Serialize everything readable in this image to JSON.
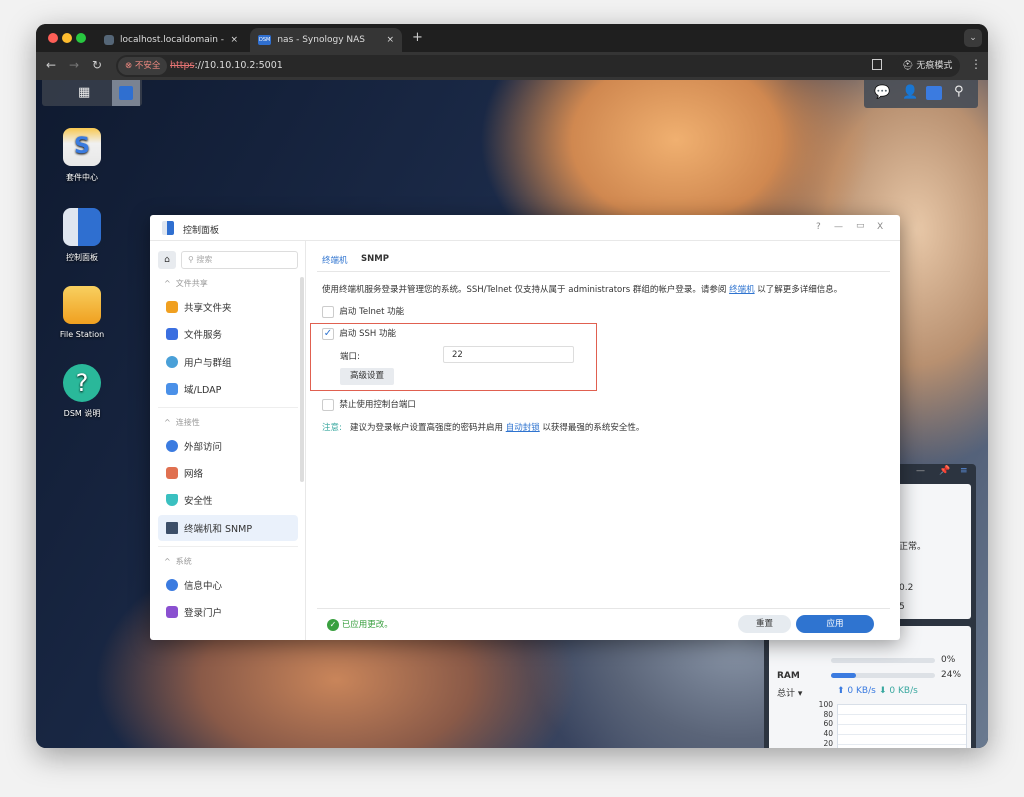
{
  "browser": {
    "tabs": [
      {
        "label": "localhost.localdomain - VMw",
        "close": "×"
      },
      {
        "label": "nas - Synology NAS",
        "close": "×",
        "favicon": "DSM"
      }
    ],
    "new_tab": "+",
    "security_label": "不安全",
    "url_scheme": "https",
    "url_rest": "://10.10.10.2:5001",
    "incognito_label": "无痕模式"
  },
  "desktop": {
    "icons": [
      {
        "label": "套件中心"
      },
      {
        "label": "控制面板"
      },
      {
        "label": "File Station"
      },
      {
        "label": "DSM 说明",
        "glyph": "?"
      }
    ]
  },
  "dialog": {
    "title": "控制面板",
    "controls": {
      "help": "?",
      "minimize": "—",
      "maximize": "▭",
      "close": "X"
    },
    "search_placeholder": "搜索",
    "sidebar": {
      "sections": [
        {
          "label": "文件共享",
          "items": [
            "共享文件夹",
            "文件服务",
            "用户与群组",
            "域/LDAP"
          ]
        },
        {
          "label": "连接性",
          "items": [
            "外部访问",
            "网络",
            "安全性",
            "终端机和 SNMP"
          ]
        },
        {
          "label": "系统",
          "items": [
            "信息中心",
            "登录门户"
          ]
        }
      ],
      "selected": "终端机和 SNMP"
    },
    "tabs": [
      {
        "label": "终端机",
        "active": true
      },
      {
        "label": "SNMP",
        "active": false
      }
    ],
    "intro_pre": "使用终端机服务登录并管理您的系统。SSH/Telnet 仅支持从属于 administrators 群组的帐户登录。请参阅",
    "intro_link": "终端机",
    "intro_post": "以了解更多详细信息。",
    "telnet": {
      "label": "启动 Telnet 功能",
      "checked": false
    },
    "ssh": {
      "label": "启动 SSH 功能",
      "checked": true,
      "port_label": "端口:",
      "port_value": "22",
      "advanced": "高级设置"
    },
    "console": {
      "label": "禁止使用控制台端口",
      "checked": false
    },
    "note_label": "注意:",
    "note_pre": "建议为登录帐户设置高强度的密码并启用",
    "note_link": "自动封锁",
    "note_post": "以获得最强的系统安全性。",
    "status": "已应用更改。",
    "reset": "重置",
    "apply": "应用",
    "accent": "#2f74d0"
  },
  "widget": {
    "health_text": "运转正常。",
    "line1": "0.2",
    "line2": "5",
    "cpu_value": "0%",
    "ram_label": "RAM",
    "ram_value": "24%",
    "ram_percent": 24,
    "total_label": "总计 ▾",
    "upload": "0 KB/s",
    "download": "0 KB/s",
    "chart_ticks": [
      "100",
      "80",
      "60",
      "40",
      "20",
      "0"
    ]
  }
}
